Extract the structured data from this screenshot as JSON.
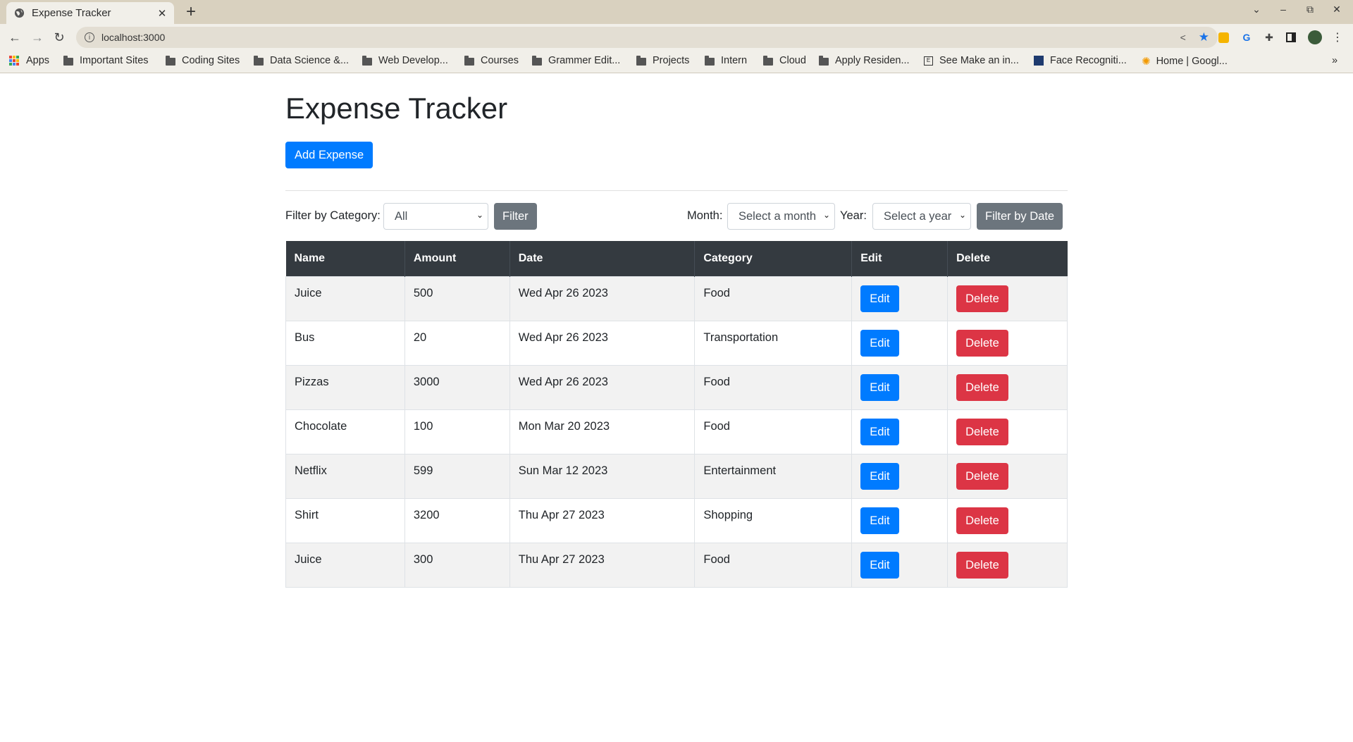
{
  "browser": {
    "tab_title": "Expense Tracker",
    "url": "localhost:3000",
    "new_tab": "+",
    "bookmarks": [
      {
        "label": "Apps",
        "icon": "apps-grid-icon"
      },
      {
        "label": "Important Sites",
        "icon": "folder-icon"
      },
      {
        "label": "Coding Sites",
        "icon": "folder-icon"
      },
      {
        "label": "Data Science &...",
        "icon": "folder-icon"
      },
      {
        "label": "Web Develop...",
        "icon": "folder-icon"
      },
      {
        "label": "Courses",
        "icon": "folder-icon"
      },
      {
        "label": "Grammer Edit...",
        "icon": "folder-icon"
      },
      {
        "label": "Projects",
        "icon": "folder-icon"
      },
      {
        "label": "Intern",
        "icon": "folder-icon"
      },
      {
        "label": "Cloud",
        "icon": "folder-icon"
      },
      {
        "label": "Apply Residen...",
        "icon": "folder-icon"
      },
      {
        "label": "See Make an in...",
        "icon": "page-icon"
      },
      {
        "label": "Face Recogniti...",
        "icon": "site-icon"
      },
      {
        "label": "Home | Googl...",
        "icon": "sun-icon"
      }
    ],
    "overflow": "»"
  },
  "page": {
    "title": "Expense Tracker",
    "add_button": "Add Expense"
  },
  "filters": {
    "category_label": "Filter by Category:",
    "category_value": "All",
    "filter_button": "Filter",
    "month_label": "Month:",
    "month_placeholder": "Select a month",
    "year_label": "Year:",
    "year_placeholder": "Select a year",
    "date_button": "Filter by Date"
  },
  "table": {
    "headers": [
      "Name",
      "Amount",
      "Date",
      "Category",
      "Edit",
      "Delete"
    ],
    "edit_label": "Edit",
    "delete_label": "Delete",
    "rows": [
      {
        "name": "Juice",
        "amount": "500",
        "date": "Wed Apr 26 2023",
        "category": "Food"
      },
      {
        "name": "Bus",
        "amount": "20",
        "date": "Wed Apr 26 2023",
        "category": "Transportation"
      },
      {
        "name": "Pizzas",
        "amount": "3000",
        "date": "Wed Apr 26 2023",
        "category": "Food"
      },
      {
        "name": "Chocolate",
        "amount": "100",
        "date": "Mon Mar 20 2023",
        "category": "Food"
      },
      {
        "name": "Netflix",
        "amount": "599",
        "date": "Sun Mar 12 2023",
        "category": "Entertainment"
      },
      {
        "name": "Shirt",
        "amount": "3200",
        "date": "Thu Apr 27 2023",
        "category": "Shopping"
      },
      {
        "name": "Juice",
        "amount": "300",
        "date": "Thu Apr 27 2023",
        "category": "Food"
      }
    ]
  },
  "colors": {
    "primary": "#007bff",
    "danger": "#dc3545",
    "secondary": "#6c757d",
    "table_header": "#343a40"
  }
}
